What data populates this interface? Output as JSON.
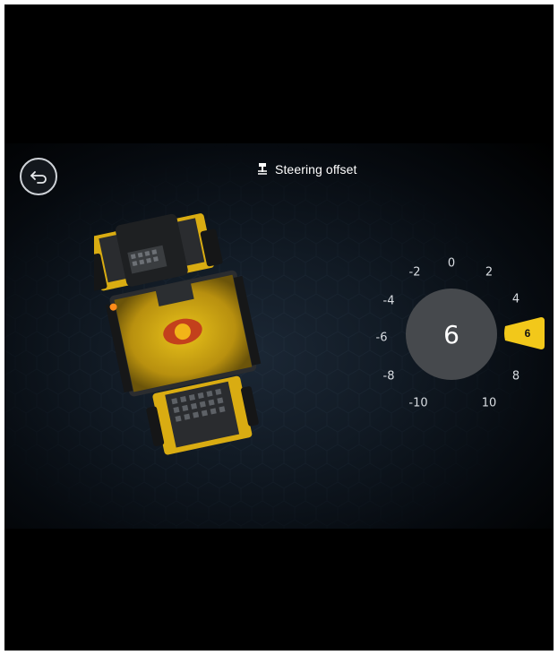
{
  "header": {
    "title": "Steering offset",
    "title_icon": "steering-offset-icon",
    "back_icon": "back-arrow-icon"
  },
  "dial": {
    "current_value": "6",
    "selected_indicator": "6",
    "ticks": [
      "0",
      "2",
      "4",
      "6",
      "8",
      "10",
      "-2",
      "-4",
      "-6",
      "-8",
      "-10"
    ]
  },
  "colors": {
    "accent": "#f2c81a",
    "dial_center": "#46494d",
    "background": "#000000",
    "scene": "#111a24"
  },
  "illustration": {
    "subject": "articulated-loader-top-view"
  }
}
